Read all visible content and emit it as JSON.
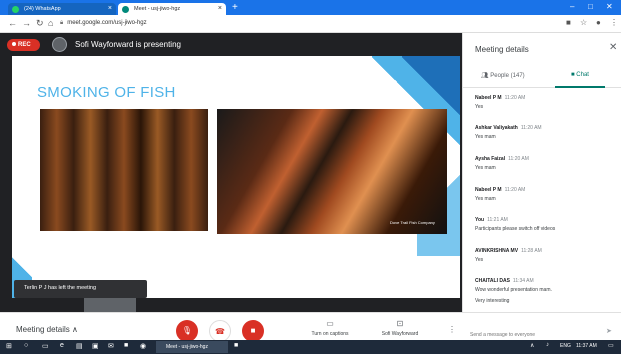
{
  "browser": {
    "tabs": [
      {
        "label": "(24) WhatsApp",
        "icon": "whatsapp-icon",
        "color": "#25d366"
      },
      {
        "label": "Meet - usj-jiwo-hgz",
        "icon": "meet-icon",
        "color": "#00897b"
      }
    ],
    "new_tab": "+",
    "url": "meet.google.com/usj-jiwo-hgz",
    "window_controls": [
      "–",
      "□",
      "✕"
    ]
  },
  "meeting": {
    "rec_label": "REC",
    "presenter_text": "Sofi Wayforward is presenting",
    "slide_title": "SMOKING OF FISH",
    "photo_watermark": "Dove Trail Fish Company",
    "toast": "Terlin P J has left the meeting"
  },
  "panel": {
    "title": "Meeting details",
    "people_tab": "People (147)",
    "chat_tab": "Chat",
    "messages": [
      {
        "sender": "Nabeel P M",
        "time": "11:20 AM",
        "lines": [
          "Yes"
        ]
      },
      {
        "sender": "Ashkar Valiyakath",
        "time": "11:20 AM",
        "lines": [
          "Yes mam"
        ]
      },
      {
        "sender": "Aysha Faizal",
        "time": "11:20 AM",
        "lines": [
          "Yes mam"
        ]
      },
      {
        "sender": "Nabeel P M",
        "time": "11:20 AM",
        "lines": [
          "Yes mam"
        ]
      },
      {
        "sender": "You",
        "time": "11:21 AM",
        "lines": [
          "Participants please switch off videos"
        ]
      },
      {
        "sender": "AVINKRISHNA MV",
        "time": "11:28 AM",
        "lines": [
          "Yes"
        ]
      },
      {
        "sender": "CHAITALI DAS",
        "time": "11:34 AM",
        "lines": [
          "Wow wonderful presentation mam.",
          "Very interesting"
        ]
      }
    ],
    "input_placeholder": "Send a message to everyone"
  },
  "controls": {
    "meeting_details": "Meeting details",
    "turn_on_captions": "Turn on captions",
    "presenter_label": "Sofi Wayforward"
  },
  "taskbar": {
    "active_item": "Meet - usj-jiwo-hgz",
    "lang": "ENG",
    "clock": "11:37 AM"
  }
}
